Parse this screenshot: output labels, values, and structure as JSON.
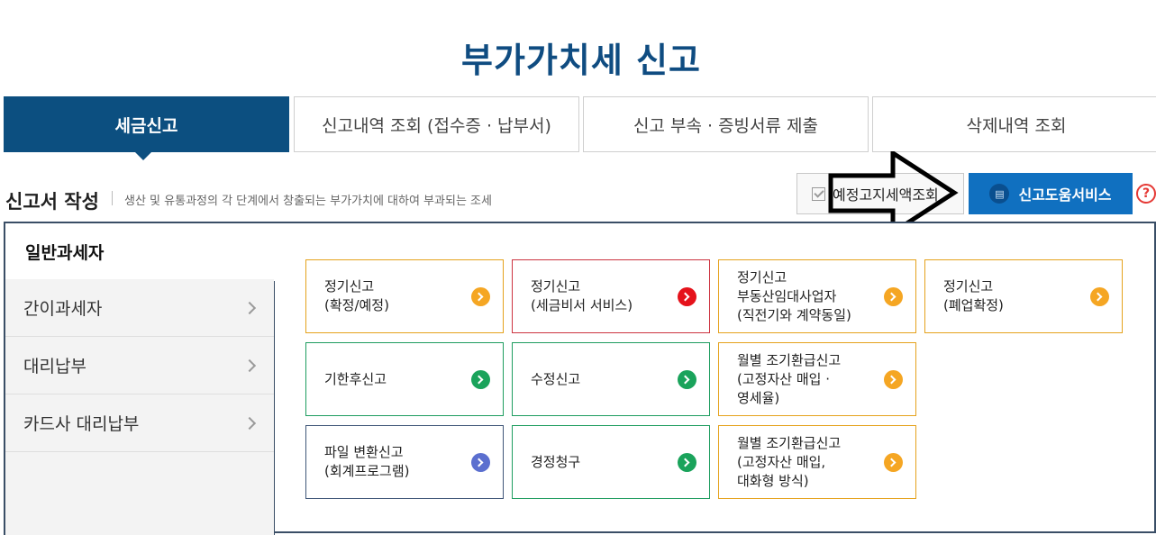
{
  "page": {
    "title": "부가가치세  신고"
  },
  "tabs": [
    {
      "label": "세금신고",
      "active": true
    },
    {
      "label": "신고내역 조회 (접수증 · 납부서)",
      "active": false
    },
    {
      "label": "신고 부속 · 증빙서류 제출",
      "active": false
    },
    {
      "label": "삭제내역 조회",
      "active": false
    }
  ],
  "section": {
    "title": "신고서 작성",
    "description": "생산 및 유통과정의 각 단계에서 창출되는 부가가치에 대하여 부과되는 조세"
  },
  "actions": {
    "estimate_label": "예정고지세액조회",
    "help_label": "신고도움서비스",
    "help_icon_char": "?"
  },
  "sidenav": {
    "active": "일반과세자",
    "items": [
      "간이과세자",
      "대리납부",
      "카드사 대리납부"
    ]
  },
  "cards": [
    {
      "label": "정기신고\n(확정/예정)",
      "accent": "orange",
      "icon_color": "#f5a623"
    },
    {
      "label": "정기신고\n(세금비서 서비스)",
      "accent": "red",
      "icon_color": "#e5121b"
    },
    {
      "label": "정기신고\n부동산임대사업자\n(직전기와 계약동일)",
      "accent": "orange",
      "icon_color": "#f5a623"
    },
    {
      "label": "정기신고\n(폐업확정)",
      "accent": "orange",
      "icon_color": "#f5a623"
    },
    {
      "label": "기한후신고",
      "accent": "green",
      "icon_color": "#1aa35b"
    },
    {
      "label": "수정신고",
      "accent": "green",
      "icon_color": "#1aa35b"
    },
    {
      "label": "월별 조기환급신고\n(고정자산 매입 ·\n영세율)",
      "accent": "orange",
      "icon_color": "#f5a623"
    },
    {
      "label": "파일 변환신고\n(회계프로그램)",
      "accent": "blue",
      "icon_color": "#5b6fcf"
    },
    {
      "label": "경정청구",
      "accent": "green",
      "icon_color": "#1aa35b"
    },
    {
      "label": "월별 조기환급신고\n(고정자산 매입,\n대화형 방식)",
      "accent": "orange",
      "icon_color": "#f5a623"
    }
  ],
  "colors": {
    "brand": "#0c4f80",
    "help_button": "#1070c0",
    "title": "#0f4c81"
  }
}
